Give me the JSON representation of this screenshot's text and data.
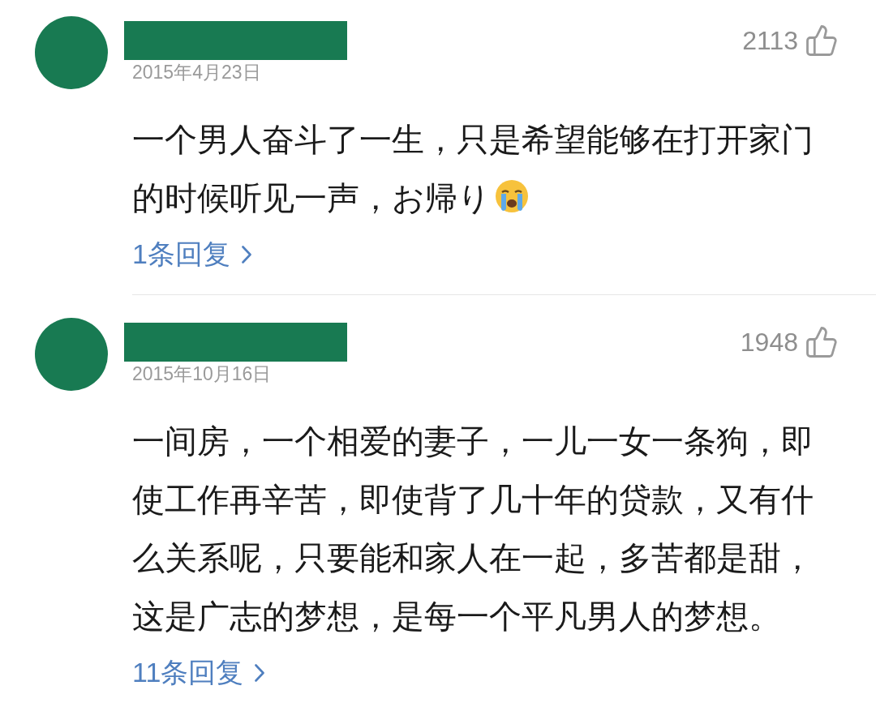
{
  "comments": [
    {
      "date": "2015年4月23日",
      "likes": "2113",
      "text": "一个男人奋斗了一生，只是希望能够在打开家门的时候听见一声，お帰り",
      "emoji": true,
      "replies": "1条回复"
    },
    {
      "date": "2015年10月16日",
      "likes": "1948",
      "text": "一间房，一个相爱的妻子，一儿一女一条狗，即使工作再辛苦，即使背了几十年的贷款，又有什么关系呢，只要能和家人在一起，多苦都是甜，这是广志的梦想，是每一个平凡男人的梦想。",
      "emoji": false,
      "replies": "11条回复"
    }
  ]
}
